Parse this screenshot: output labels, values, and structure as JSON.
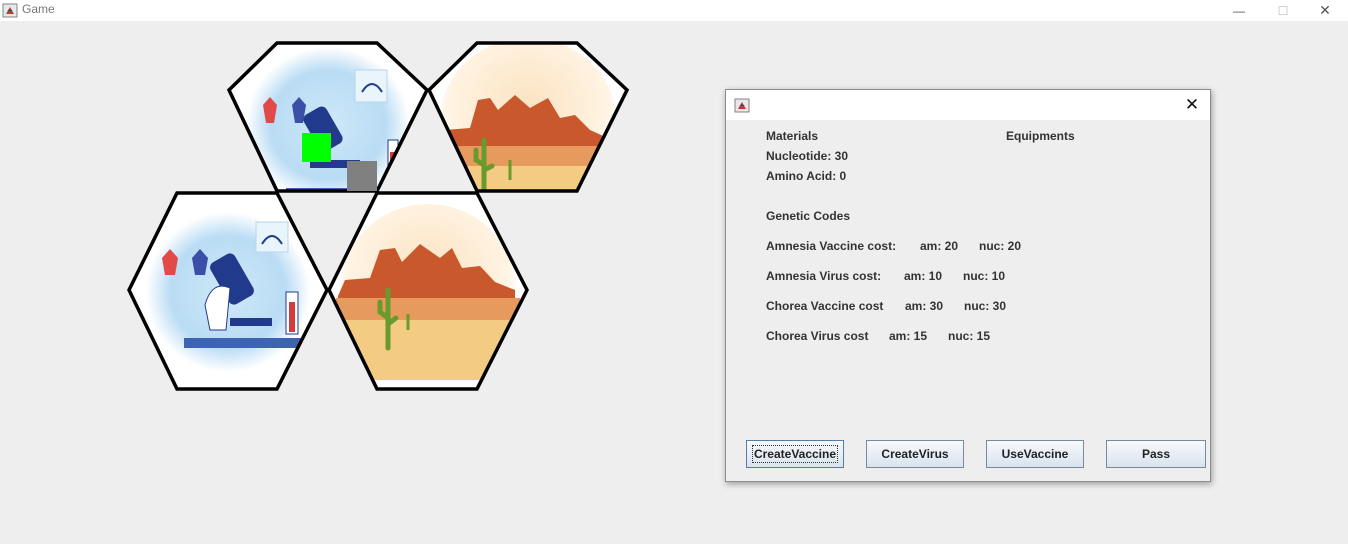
{
  "window": {
    "title": "Game",
    "controls": {
      "minimize": "—",
      "maximize": "☐",
      "close": "✕"
    }
  },
  "board": {
    "tiles": [
      {
        "type": "laboratory",
        "has_virologist_marker": true,
        "has_equipment_marker": true
      },
      {
        "type": "desert"
      },
      {
        "type": "laboratory"
      },
      {
        "type": "desert"
      }
    ],
    "colors": {
      "virologist_marker": "#00ff00",
      "equipment_marker": "#808080"
    }
  },
  "dialog": {
    "close": "✕",
    "materials_header": "Materials",
    "equipments_header": "Equipments",
    "nucleotide": "Nucleotide: 30",
    "amino_acid": "Amino Acid: 0",
    "genetic_codes_header": "Genetic Codes",
    "codes": [
      {
        "name": "Amnesia Vaccine cost:",
        "am": "am: 20",
        "nuc": "nuc: 20"
      },
      {
        "name": "Amnesia Virus cost:",
        "am": "am: 10",
        "nuc": "nuc: 10"
      },
      {
        "name": "Chorea Vaccine cost",
        "am": "am: 30",
        "nuc": "nuc: 30"
      },
      {
        "name": "Chorea Virus cost",
        "am": "am: 15",
        "nuc": "nuc: 15"
      }
    ],
    "buttons": {
      "create_vaccine": "CreateVaccine",
      "create_virus": "CreateVirus",
      "use_vaccine": "UseVaccine",
      "pass": "Pass"
    }
  }
}
